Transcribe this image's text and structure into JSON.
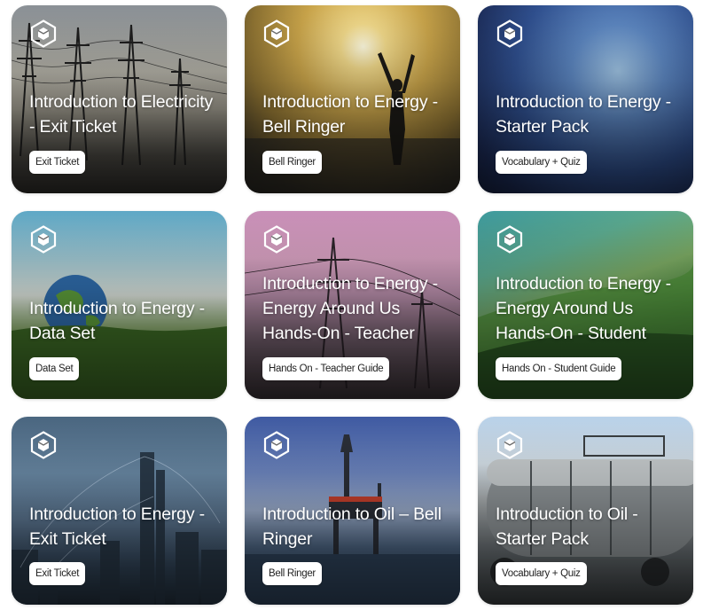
{
  "cards": [
    {
      "title": "Introduction to Electricity - Exit Ticket",
      "tag": "Exit Ticket"
    },
    {
      "title": "Introduction to Energy - Bell Ringer",
      "tag": "Bell Ringer"
    },
    {
      "title": "Introduction to Energy - Starter Pack",
      "tag": "Vocabulary + Quiz"
    },
    {
      "title": "Introduction to Energy - Data Set",
      "tag": "Data Set"
    },
    {
      "title": "Introduction to Energy - Energy Around Us Hands-On - Teacher",
      "tag": "Hands On - Teacher Guide"
    },
    {
      "title": "Introduction to Energy - Energy Around Us Hands-On - Student",
      "tag": "Hands On - Student Guide"
    },
    {
      "title": "Introduction to Energy - Exit Ticket",
      "tag": "Exit Ticket"
    },
    {
      "title": "Introduction to Oil – Bell Ringer",
      "tag": "Bell Ringer"
    },
    {
      "title": "Introduction to Oil - Starter Pack",
      "tag": "Vocabulary + Quiz"
    }
  ],
  "icons": {
    "card_logo": "hexagon-cube-icon"
  }
}
